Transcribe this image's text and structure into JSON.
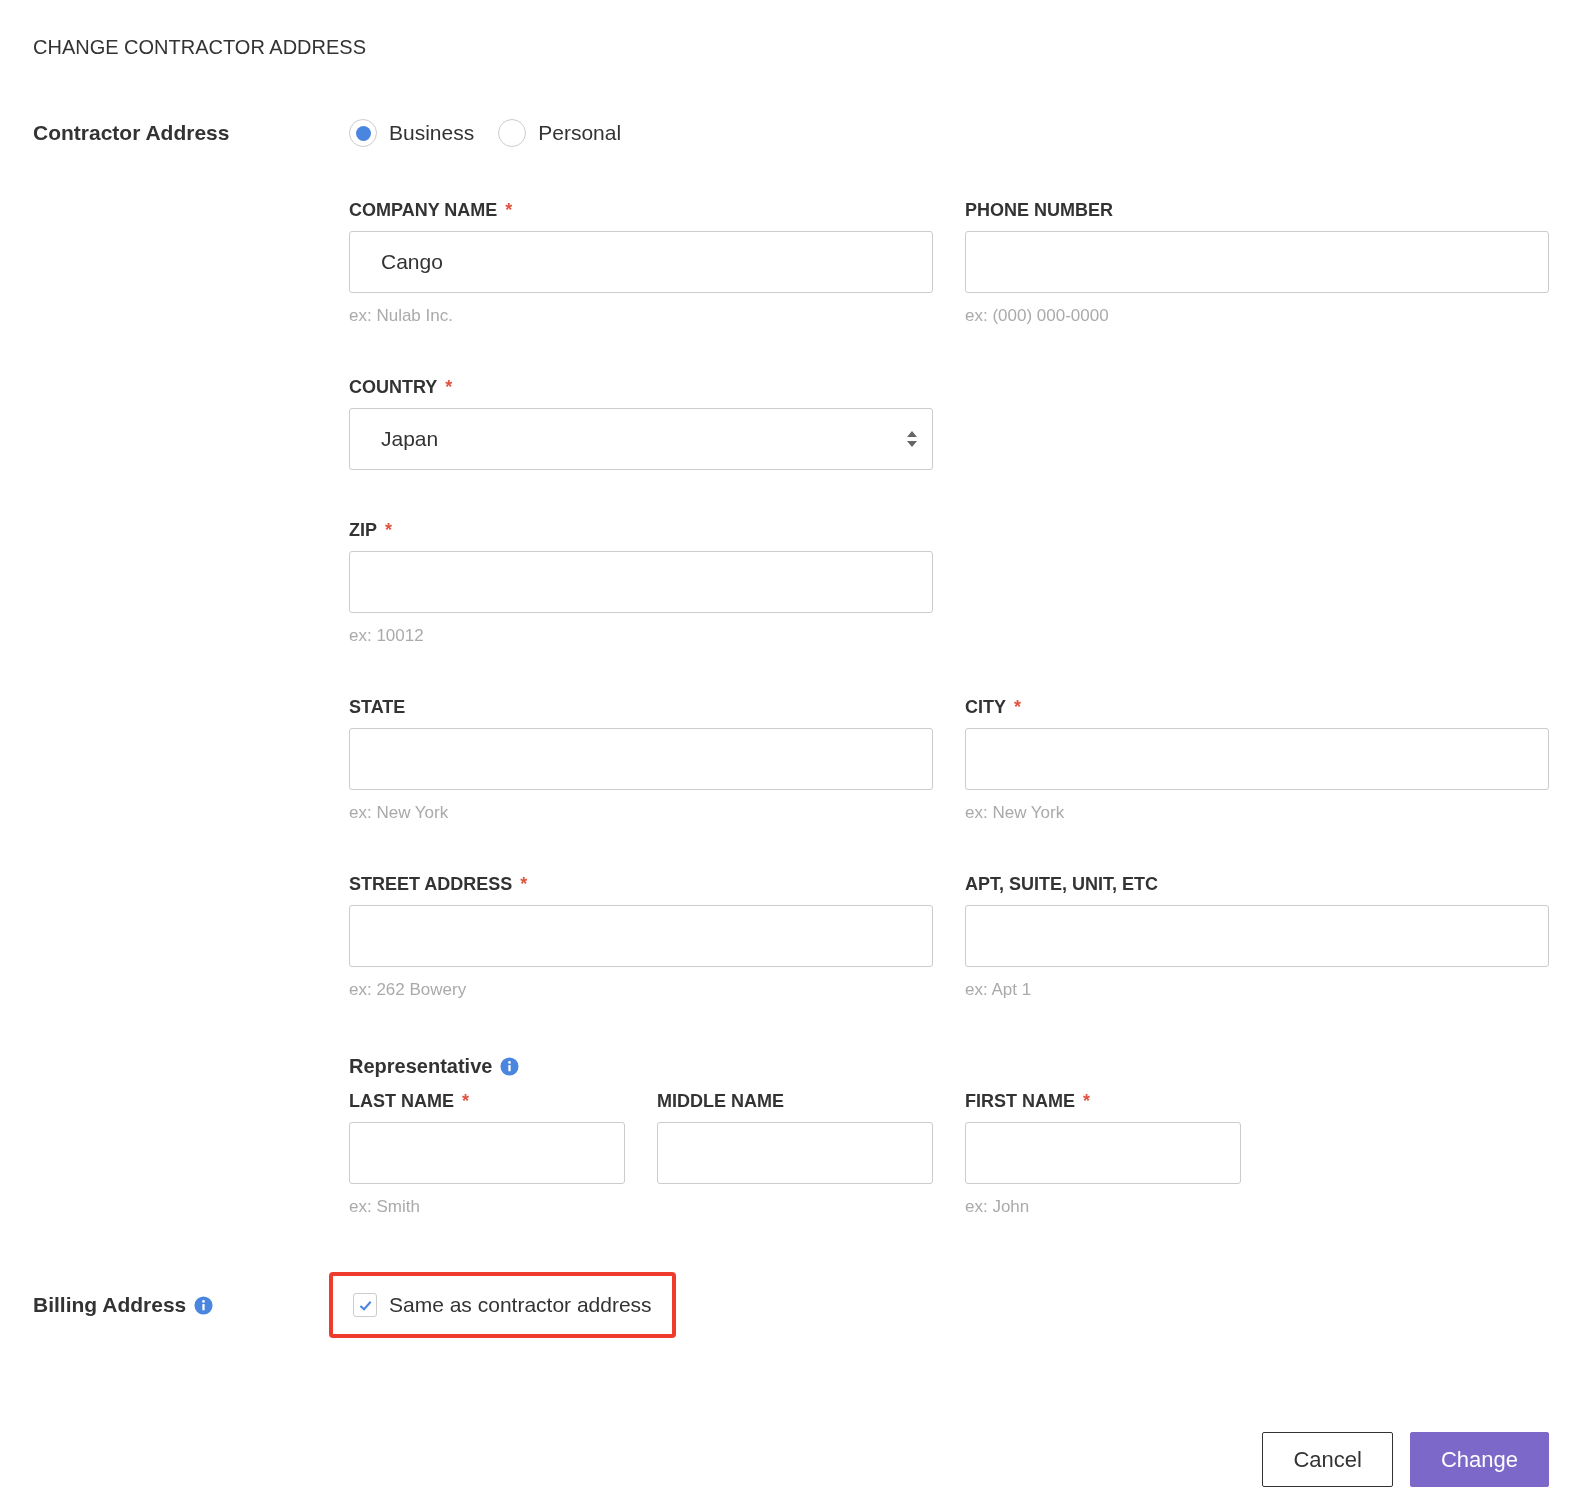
{
  "title": "CHANGE CONTRACTOR ADDRESS",
  "contractor_address": {
    "label": "Contractor Address",
    "options": [
      {
        "label": "Business",
        "selected": true
      },
      {
        "label": "Personal",
        "selected": false
      }
    ]
  },
  "rows": [
    {
      "fields": [
        {
          "label": "COMPANY NAME",
          "required_mark": "*",
          "kind": "text",
          "value": "Cango",
          "hint": "ex: Nulab Inc."
        },
        {
          "label": "PHONE NUMBER",
          "kind": "text",
          "hint": "ex: (000) 000-0000"
        }
      ]
    },
    {
      "fields": [
        {
          "label": "COUNTRY",
          "required_mark": "*",
          "kind": "select",
          "value": "Japan"
        }
      ]
    },
    {
      "fields": [
        {
          "label": "ZIP",
          "required_mark": "*",
          "kind": "text",
          "hint": "ex: 10012"
        }
      ]
    },
    {
      "fields": [
        {
          "label": "STATE",
          "kind": "text",
          "hint": "ex: New York"
        },
        {
          "label": "CITY",
          "required_mark": "*",
          "kind": "text",
          "hint": "ex: New York"
        }
      ]
    },
    {
      "fields": [
        {
          "label": "STREET ADDRESS",
          "required_mark": "*",
          "kind": "text",
          "hint": "ex: 262 Bowery"
        },
        {
          "label": "APT, SUITE, UNIT, ETC",
          "kind": "text",
          "hint": "ex: Apt 1"
        }
      ]
    }
  ],
  "representative": {
    "label": "Representative",
    "fields": [
      {
        "label": "LAST NAME",
        "required_mark": "*",
        "kind": "text",
        "hint": "ex: Smith"
      },
      {
        "label": "MIDDLE NAME",
        "kind": "text"
      },
      {
        "label": "FIRST NAME",
        "required_mark": "*",
        "kind": "text",
        "hint": "ex: John"
      }
    ]
  },
  "billing_address": {
    "label": "Billing Address",
    "checkbox": {
      "label": "Same as contractor address",
      "checked": true
    },
    "highlighted": true
  },
  "buttons": [
    {
      "label": "Cancel",
      "kind": "secondary"
    },
    {
      "label": "Change",
      "kind": "primary"
    }
  ]
}
